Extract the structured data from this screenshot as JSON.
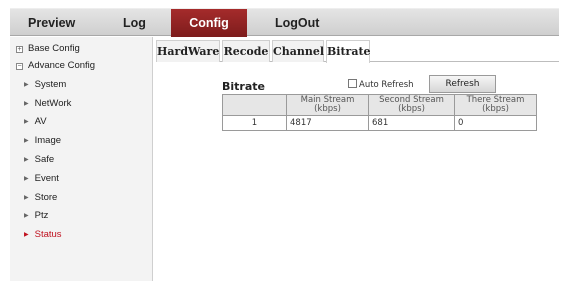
{
  "nav": {
    "items": [
      {
        "label": "Preview"
      },
      {
        "label": "Log"
      },
      {
        "label": "Config"
      },
      {
        "label": "LogOut"
      }
    ],
    "active_index": 2
  },
  "sidebar": {
    "base_config": {
      "box": "+",
      "label": "Base Config"
    },
    "advance_config": {
      "box": "−",
      "label": "Advance Config"
    },
    "items": [
      {
        "label": "System"
      },
      {
        "label": "NetWork"
      },
      {
        "label": "AV"
      },
      {
        "label": "Image"
      },
      {
        "label": "Safe"
      },
      {
        "label": "Event"
      },
      {
        "label": "Store"
      },
      {
        "label": "Ptz"
      },
      {
        "label": "Status"
      }
    ],
    "active_index": 8,
    "arrow_glyph": "▶"
  },
  "tabs": {
    "items": [
      {
        "label": "HardWare"
      },
      {
        "label": "Recode"
      },
      {
        "label": "Channel"
      },
      {
        "label": "Bitrate"
      }
    ],
    "active_index": 3
  },
  "bitrate": {
    "title": "Bitrate",
    "auto_refresh": {
      "label": "Auto Refresh",
      "checked": false
    },
    "refresh_label": "Refresh",
    "table": {
      "headers": [
        {
          "line1": "",
          "line2": ""
        },
        {
          "line1": "Main Stream",
          "line2": "(kbps)"
        },
        {
          "line1": "Second Stream",
          "line2": "(kbps)"
        },
        {
          "line1": "There Stream",
          "line2": "(kbps)"
        }
      ],
      "rows": [
        [
          "1",
          "4817",
          "681",
          "0"
        ]
      ]
    }
  },
  "colors": {
    "accent_red": "#a52b2b",
    "active_sidebar_text": "#c0111f"
  }
}
